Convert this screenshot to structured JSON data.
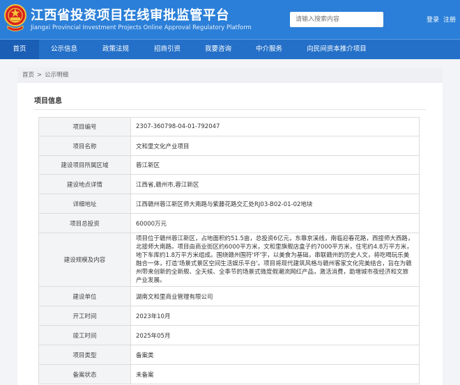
{
  "header": {
    "title": "江西省投资项目在线审批监管平台",
    "subtitle": "Jiangxi Provincial Investment Projects Online Approval Regulatory Platform",
    "search_placeholder": "请输入搜索内容",
    "login": "登录",
    "register": "注册"
  },
  "nav": [
    "首页",
    "公示信息",
    "政策法规",
    "招商引资",
    "我要咨询",
    "中介服务",
    "向民间资本推介项目"
  ],
  "breadcrumb": [
    "首页",
    ">",
    "公示明细"
  ],
  "section_title": "项目信息",
  "rows": [
    {
      "label": "项目编号",
      "value": "2307-360798-04-01-792047"
    },
    {
      "label": "项目名称",
      "value": "文和里文化产业项目"
    },
    {
      "label": "建设项目所属区域",
      "value": "蓉江新区"
    },
    {
      "label": "建设地点详情",
      "value": "江西省,赣州市,蓉江新区"
    },
    {
      "label": "详细地址",
      "value": "江西赣州蓉江新区师大南路与紫藤花路交汇处RJ03-B02-01-02地块"
    },
    {
      "label": "项目总投资",
      "value": "60000万元"
    },
    {
      "label": "建设规模及内容",
      "value": "项目位于赣州蓉江新区，占地面积约51.5亩，总投资6亿元，东靠京溪线，南临迎春花路，西接师大西路，北接师大南路。项目由商业街区约6000平方米，文和里旗舰店盒子约7000平方米，住宅约4.8万平方米，地下车库约1.8万平方米组成。围绕赣州围符'坏'字，以美食为基础，串联赣州的历史人文，将吃喝玩乐美融合一体，打造'场景式景区空间生活娱乐平台'。项目将现代建筑风格与赣州客家文化完美结合，旨在为赣州带来创新的全新舰、全天候、全季节的场景式微度假潮流网红产品，激活消费，助增城市夜经济和文旅产业发展。"
    },
    {
      "label": "建设单位",
      "value": "湖南文和里商业管理有限公司"
    },
    {
      "label": "开工时间",
      "value": "2023年10月"
    },
    {
      "label": "竣工时间",
      "value": "2025年05月"
    },
    {
      "label": "项目类型",
      "value": "备案类"
    },
    {
      "label": "备案状态",
      "value": "未备案"
    }
  ],
  "colors": {
    "header_bg": "#2b7fd8",
    "nav_bg": "#2470c8",
    "nav_active": "#1a5fb5",
    "label_bg": "#f3f4f6"
  }
}
